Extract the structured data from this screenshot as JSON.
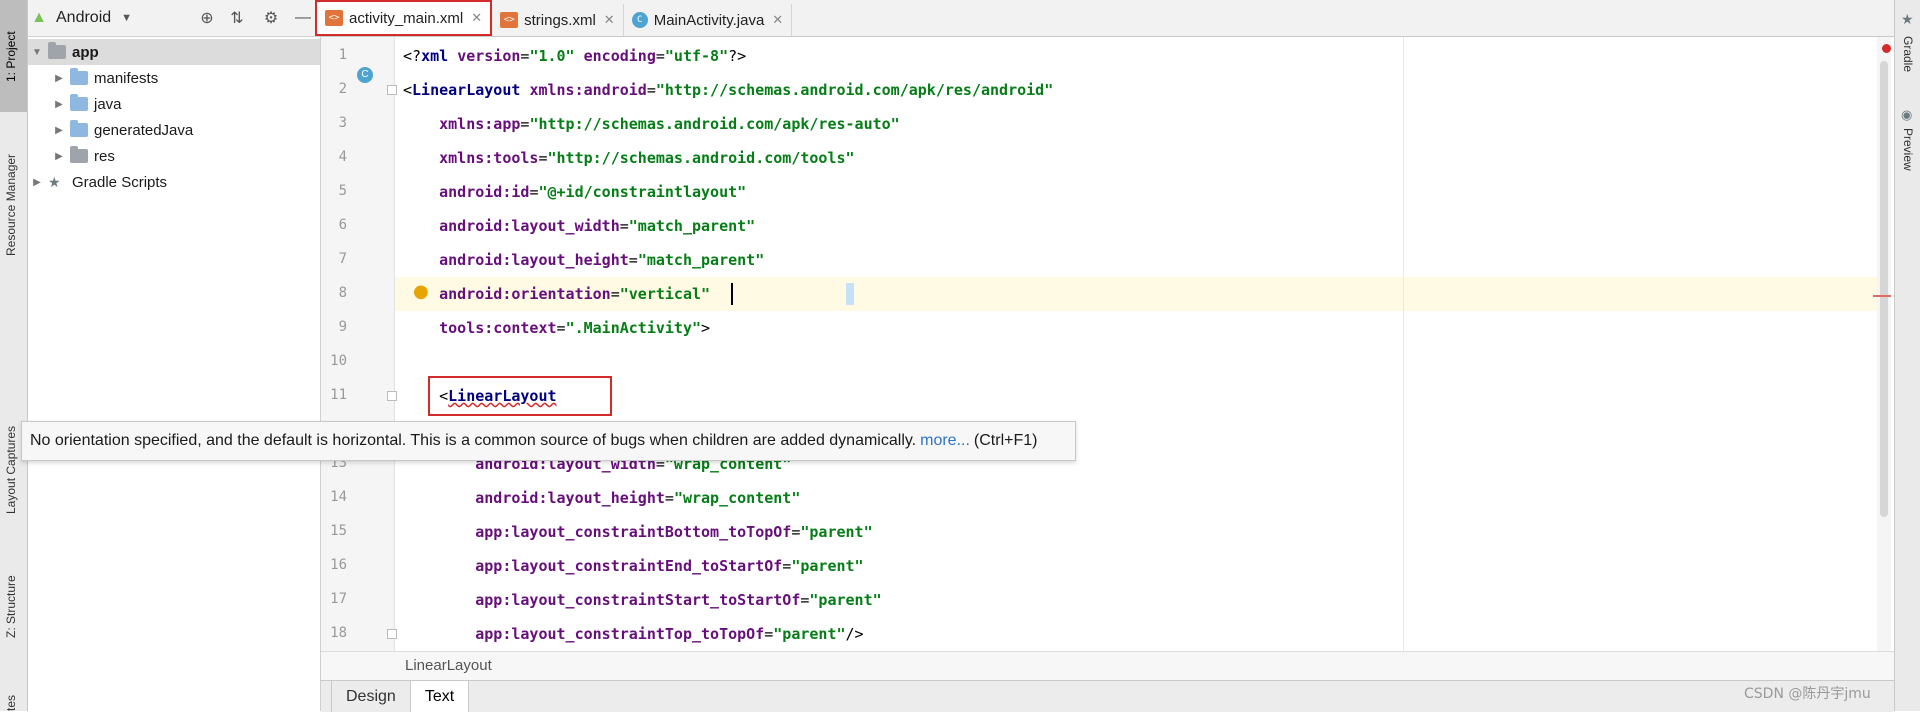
{
  "left_strip": {
    "tabs": [
      "1: Project",
      "Resource Manager",
      "Layout Captures",
      "Z: Structure",
      "tes"
    ]
  },
  "right_strip": {
    "tabs": [
      "Gradle",
      "Preview"
    ]
  },
  "project_panel": {
    "view_selector": "Android",
    "tree": [
      {
        "label": "app",
        "level": 0,
        "expanded": true,
        "selected": true
      },
      {
        "label": "manifests",
        "level": 1
      },
      {
        "label": "java",
        "level": 1
      },
      {
        "label": "generatedJava",
        "level": 1
      },
      {
        "label": "res",
        "level": 1
      },
      {
        "label": "Gradle Scripts",
        "level": 0
      }
    ]
  },
  "editor_tabs": [
    {
      "label": "activity_main.xml",
      "type": "xml",
      "active": true
    },
    {
      "label": "strings.xml",
      "type": "xml",
      "active": false
    },
    {
      "label": "MainActivity.java",
      "type": "java",
      "active": false
    }
  ],
  "code_lines": [
    {
      "n": "1",
      "html": "<span class='punc'>&lt;?</span><span class='tag'>xml </span><span class='attr'>version</span><span class='punc'>=</span><span class='val'>\"1.0\"</span> <span class='attr'>encoding</span><span class='punc'>=</span><span class='val'>\"utf-8\"</span><span class='punc'>?&gt;</span>"
    },
    {
      "n": "2",
      "html": "<span class='punc'>&lt;</span><span class='tag'>LinearLayout </span><span class='attr'>xmlns:android</span><span class='punc'>=</span><span class='val'>\"http://schemas.android.com/apk/res/android\"</span>"
    },
    {
      "n": "3",
      "html": "    <span class='attr'>xmlns:app</span><span class='punc'>=</span><span class='val'>\"http://schemas.android.com/apk/res-auto\"</span>"
    },
    {
      "n": "4",
      "html": "    <span class='attr'>xmlns:tools</span><span class='punc'>=</span><span class='val'>\"http://schemas.android.com/tools\"</span>"
    },
    {
      "n": "5",
      "html": "    <span class='attr'>android:id</span><span class='punc'>=</span><span class='val'>\"@+id/constraintlayout\"</span>"
    },
    {
      "n": "6",
      "html": "    <span class='attr'>android:layout_width</span><span class='punc'>=</span><span class='val'>\"match_parent\"</span>"
    },
    {
      "n": "7",
      "html": "    <span class='attr'>android:layout_height</span><span class='punc'>=</span><span class='val'>\"match_parent\"</span>"
    },
    {
      "n": "8",
      "html": "    <span class='attr'>android:orientation</span><span class='punc'>=</span><span class='val'>\"vertical\"</span>"
    },
    {
      "n": "9",
      "html": "    <span class='attr'>tools:context</span><span class='punc'>=</span><span class='val'>\".MainActivity\"</span><span class='punc'>&gt;</span>"
    },
    {
      "n": "10",
      "html": ""
    },
    {
      "n": "11",
      "html": "    <span class='punc'>&lt;</span><span class='tag' style='text-decoration:underline wavy #d42a2a;'>LinearLayout</span>"
    },
    {
      "n": "12",
      "html": ""
    },
    {
      "n": "13",
      "html": "        <span class='attr'>android:layout_width</span><span class='punc'>=</span><span class='val'>\"wrap_content\"</span>"
    },
    {
      "n": "14",
      "html": "        <span class='attr'>android:layout_height</span><span class='punc'>=</span><span class='val'>\"wrap_content\"</span>"
    },
    {
      "n": "15",
      "html": "        <span class='attr'>app:layout_constraintBottom_toTopOf</span><span class='punc'>=</span><span class='val'>\"parent\"</span>"
    },
    {
      "n": "16",
      "html": "        <span class='attr'>app:layout_constraintEnd_toStartOf</span><span class='punc'>=</span><span class='val'>\"parent\"</span>"
    },
    {
      "n": "17",
      "html": "        <span class='attr'>app:layout_constraintStart_toStartOf</span><span class='punc'>=</span><span class='val'>\"parent\"</span>"
    },
    {
      "n": "18",
      "html": "        <span class='attr'>app:layout_constraintTop_toTopOf</span><span class='punc'>=</span><span class='val'>\"parent\"</span><span class='punc'>/&gt;</span>"
    }
  ],
  "tooltip": {
    "message": "No orientation specified, and the default is horizontal. This is a common source of bugs when children are added dynamically.",
    "link": "more...",
    "shortcut": "(Ctrl+F1)"
  },
  "breadcrumb": "LinearLayout",
  "bottom_tabs": [
    {
      "label": "Design",
      "active": false
    },
    {
      "label": "Text",
      "active": true
    }
  ],
  "watermark": "CSDN @陈丹宇jmu"
}
